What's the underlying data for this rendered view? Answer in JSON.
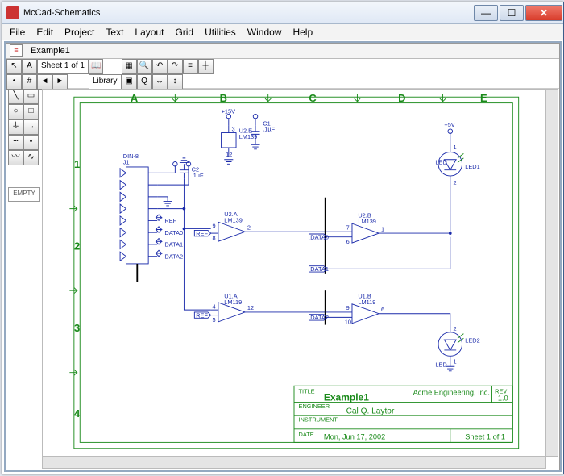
{
  "window": {
    "title": "McCad-Schematics",
    "buttons": {
      "min": "—",
      "max": "☐",
      "close": "✕"
    }
  },
  "menu": {
    "file": "File",
    "edit": "Edit",
    "project": "Project",
    "text": "Text",
    "layout": "Layout",
    "grid": "Grid",
    "utilities": "Utilities",
    "window": "Window",
    "help": "Help"
  },
  "doc": {
    "name": "Example1",
    "sheet": "Sheet 1 of 1",
    "library": "Library"
  },
  "palette": {
    "empty": "EMPTY"
  },
  "grid": {
    "cols": [
      "A",
      "B",
      "C",
      "D",
      "E"
    ],
    "rows": [
      "1",
      "2",
      "3",
      "4"
    ]
  },
  "components": {
    "din8": {
      "ref": "J1",
      "name": "DIN-8"
    },
    "c1": {
      "ref": "C1",
      "val": ".1µF"
    },
    "c2": {
      "ref": "C2",
      "val": ".1µF"
    },
    "v15": "+15V",
    "v5": "+5V",
    "u2e": {
      "ref": "U2.E",
      "part": "LM139",
      "pins": {
        "a": "3",
        "b": "12"
      }
    },
    "u2a": {
      "ref": "U2.A",
      "part": "LM139",
      "pins": {
        "p": "9",
        "n": "8",
        "o": "2"
      }
    },
    "u2b": {
      "ref": "U2.B",
      "part": "LM139",
      "pins": {
        "p": "7",
        "n": "6",
        "o": "1"
      }
    },
    "u1a": {
      "ref": "U1.A",
      "part": "LM119",
      "pins": {
        "p": "4",
        "n": "5",
        "o": "12"
      }
    },
    "u1b": {
      "ref": "U1.B",
      "part": "LM119",
      "pins": {
        "p": "9",
        "n": "10",
        "o": "6"
      }
    },
    "led1": {
      "ref": "LED1",
      "part": "LED",
      "pins": {
        "a": "1",
        "k": "2"
      }
    },
    "led2": {
      "ref": "LED2",
      "part": "LED",
      "pins": {
        "a": "2",
        "k": "1"
      }
    }
  },
  "nets": {
    "ref": "REF",
    "data0": "DATA0",
    "data1": "DATA1",
    "data2": "DATA2"
  },
  "titleblock": {
    "title_l": "TITLE",
    "title": "Example1",
    "company": "Acme Engineering, Inc.",
    "rev_l": "REV",
    "rev": "1.0",
    "eng_l": "ENGINEER",
    "eng": "Cal Q. Laytor",
    "inst_l": "INSTRUMENT",
    "date_l": "DATE",
    "date": "Mon, Jun 17, 2002",
    "sheet": "Sheet 1 of 1"
  }
}
